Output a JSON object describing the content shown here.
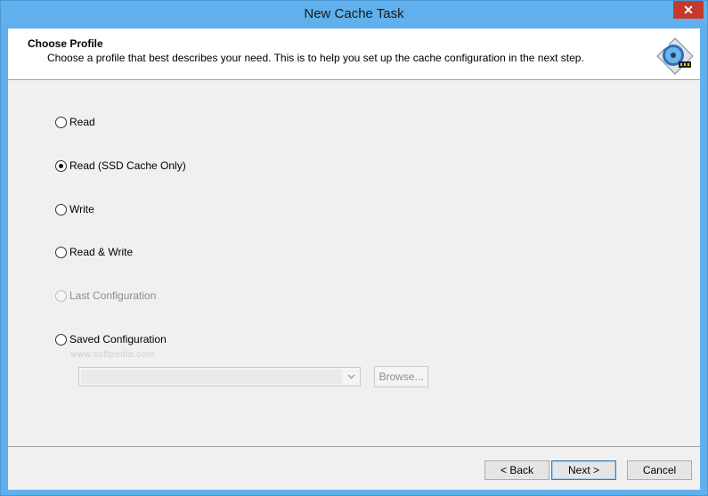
{
  "window": {
    "title": "New Cache Task",
    "close_label": "✕"
  },
  "header": {
    "title": "Choose Profile",
    "description": "Choose a profile that best describes your need. This is to help you set up the cache configuration in the next step.",
    "icon": "cache-disk-icon"
  },
  "profiles": [
    {
      "label": "Read",
      "checked": false,
      "disabled": false
    },
    {
      "label": "Read (SSD Cache Only)",
      "checked": true,
      "disabled": false
    },
    {
      "label": "Write",
      "checked": false,
      "disabled": false
    },
    {
      "label": "Read & Write",
      "checked": false,
      "disabled": false
    },
    {
      "label": "Last Configuration",
      "checked": false,
      "disabled": true
    },
    {
      "label": "Saved Configuration",
      "checked": false,
      "disabled": false
    }
  ],
  "saved_config": {
    "selected": "",
    "browse_label": "Browse..."
  },
  "watermark": "www.softpedia.com",
  "buttons": {
    "back": "< Back",
    "next": "Next >",
    "cancel": "Cancel"
  }
}
